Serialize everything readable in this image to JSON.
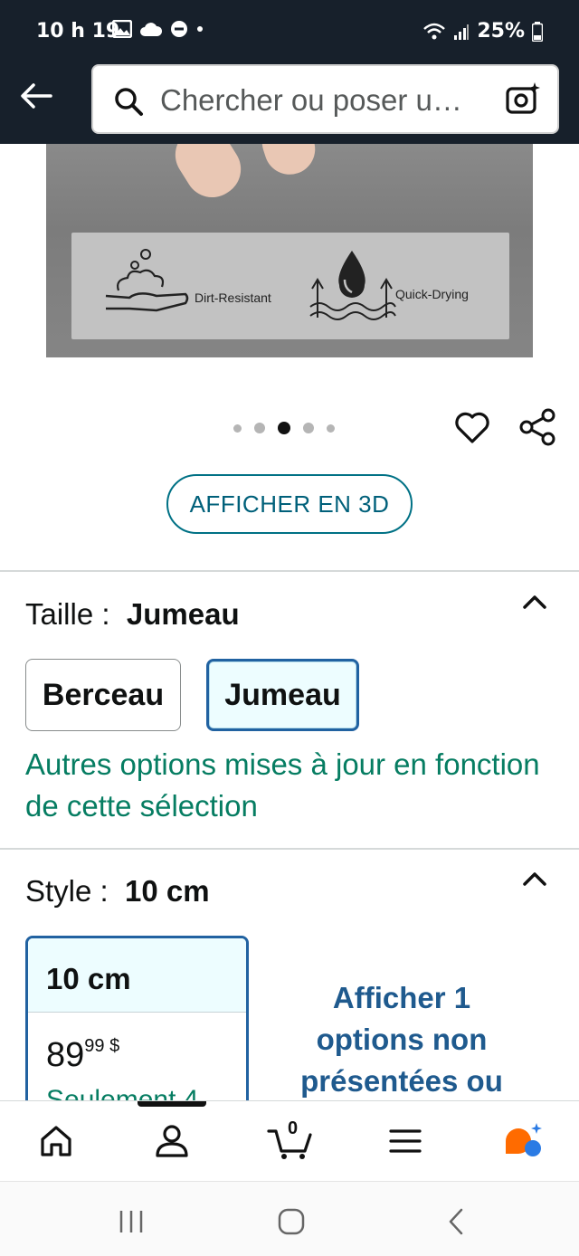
{
  "status_bar": {
    "time": "10 h 19",
    "battery": "25%"
  },
  "search": {
    "placeholder": "Chercher ou poser u…"
  },
  "product_image": {
    "labels": [
      "Dirt-Resistant",
      "Quick-Drying"
    ]
  },
  "carousel": {
    "count": 5,
    "active_index": 2
  },
  "view_3d_label": "AFFICHER EN 3D",
  "size": {
    "label": "Taille :",
    "value": "Jumeau",
    "options": [
      "Berceau",
      "Jumeau"
    ],
    "selected": "Jumeau",
    "note": "Autres options mises à jour en fonction de cette sélection"
  },
  "style": {
    "label": "Style :",
    "value": "10 cm",
    "card": {
      "title": "10 cm",
      "price_whole": "89",
      "price_cents": "99 $",
      "stock": "Seulement 4"
    },
    "more_options": "Afficher 1 options non présentées ou"
  },
  "bottom_nav": {
    "items": [
      "home-icon",
      "account-icon",
      "cart-icon",
      "menu-icon",
      "rufus-icon"
    ],
    "cart_count": "0",
    "accent": "#ff6b00"
  },
  "colors": {
    "header_bg": "#17202b",
    "link": "#007185",
    "success": "#067d62",
    "selected_border": "#2162a1"
  }
}
